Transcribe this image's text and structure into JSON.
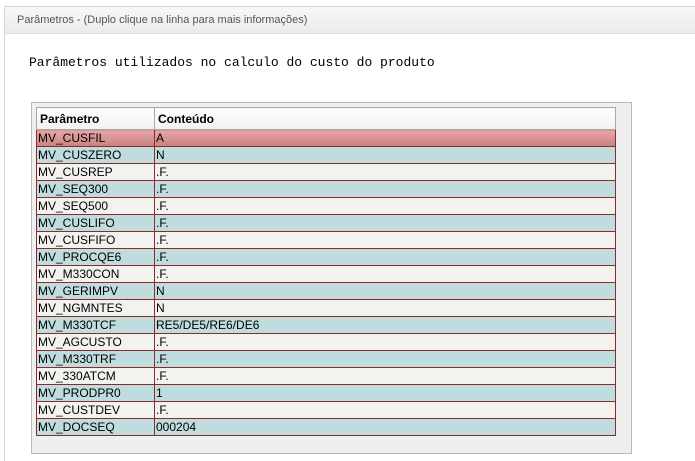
{
  "panel": {
    "header": "Parâmetros - (Duplo clique na linha para mais informações)",
    "section_title": "Parâmetros utilizados no calculo do custo do produto"
  },
  "grid": {
    "columns": [
      "Parâmetro",
      "Conteúdo"
    ],
    "selected_row": 0,
    "rows": [
      {
        "param": "MV_CUSFIL",
        "value": "A"
      },
      {
        "param": "MV_CUSZERO",
        "value": "N"
      },
      {
        "param": "MV_CUSREP",
        "value": ".F."
      },
      {
        "param": "MV_SEQ300",
        "value": ".F."
      },
      {
        "param": "MV_SEQ500",
        "value": ".F."
      },
      {
        "param": "MV_CUSLIFO",
        "value": ".F."
      },
      {
        "param": "MV_CUSFIFO",
        "value": ".F."
      },
      {
        "param": "MV_PROCQE6",
        "value": ".F."
      },
      {
        "param": "MV_M330CON",
        "value": ".F."
      },
      {
        "param": "MV_GERIMPV",
        "value": "N"
      },
      {
        "param": "MV_NGMNTES",
        "value": "N"
      },
      {
        "param": "MV_M330TCF",
        "value": "RE5/DE5/RE6/DE6"
      },
      {
        "param": "MV_AGCUSTO",
        "value": ".F."
      },
      {
        "param": "MV_M330TRF",
        "value": ".F."
      },
      {
        "param": "MV_330ATCM",
        "value": ".F."
      },
      {
        "param": "MV_PRODPR0",
        "value": "1"
      },
      {
        "param": "MV_CUSTDEV",
        "value": ".F."
      },
      {
        "param": "MV_DOCSEQ",
        "value": "000204"
      }
    ]
  },
  "colors": {
    "row_even": "#f4f2ee",
    "row_odd": "#bfdcde",
    "row_selected": "#d99595",
    "grid_border": "#8c2a2a"
  }
}
